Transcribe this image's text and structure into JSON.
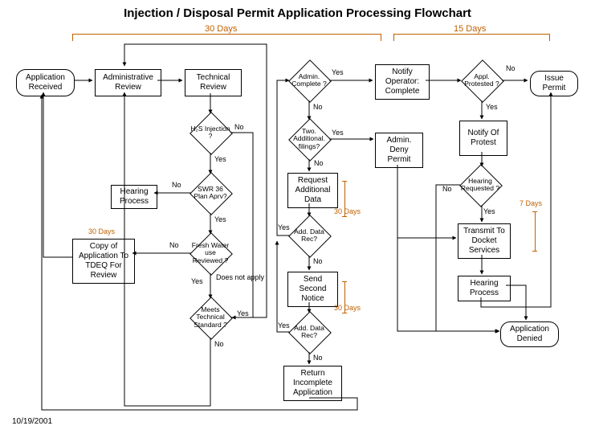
{
  "title": "Injection / Disposal Permit Application Processing Flowchart",
  "date": "10/19/2001",
  "spans": {
    "s30": "30 Days",
    "s15": "15  Days"
  },
  "nodes": {
    "app_rec": "Application\nReceived",
    "admin_rev": "Administrative\nReview",
    "tech_rev": "Technical\nReview",
    "h2s": "H₂S\nInjection\n?",
    "swr": "SWR 36\nPlan\nAprv?",
    "hearing1": "Hearing\nProcess",
    "copy": "Copy of\nApplication\nTo TDEQ\nFor Review",
    "fwater": "Fresh\nWater use\nReviewed\n?",
    "meets": "Meets\nTechnical\nStandard\n?",
    "admin_c": "Admin.\nComplete\n?",
    "two_add": "Two.\nAdditional.\nfilings?",
    "req_add": "Request\nAdditional\nData",
    "add1": "Add.\nData\nRec?",
    "send2": "Send\nSecond\nNotice",
    "add2": "Add.\nData\nRec?",
    "ret_inc": "Return\nIncomplete\nApplication",
    "notify_op": "Notify\nOperator:\nComplete",
    "admin_deny": "Admin.\nDeny\nPermit",
    "appl_prot": "Appl.\nProtested\n?",
    "issue": "Issue\nPermit",
    "notify_prot": "Notify\nOf\nProtest",
    "hear_req": "Hearing\nRequested\n?",
    "transmit": "Transmit\nTo Docket\nServices",
    "hearing2": "Hearing\nProcess",
    "app_den": "Application\nDenied"
  },
  "labels": {
    "yes": "Yes",
    "no": "No",
    "dna": "Does not\napply",
    "d30": "30 Days",
    "d7": "7 Days"
  }
}
